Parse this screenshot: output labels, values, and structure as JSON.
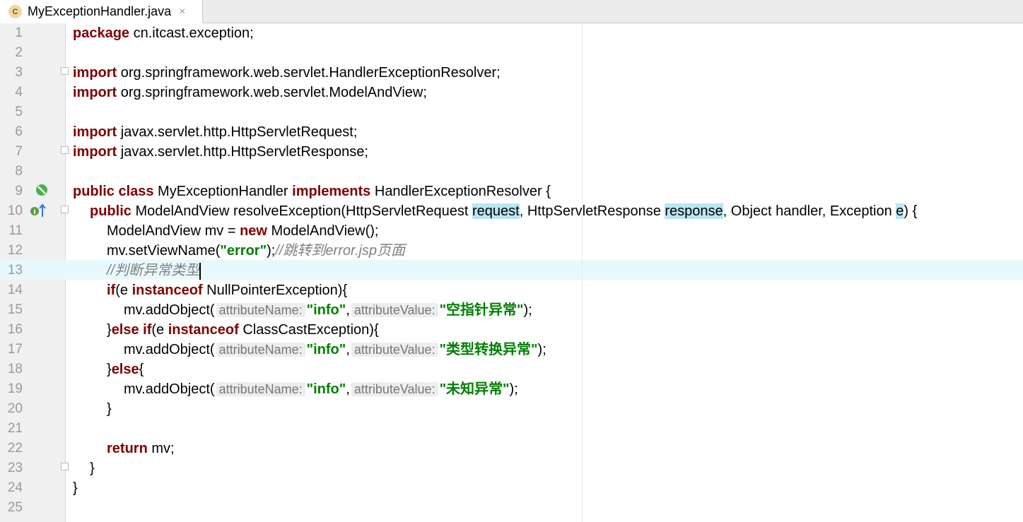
{
  "tab": {
    "icon": "C",
    "title": "MyExceptionHandler.java",
    "close": "×"
  },
  "lines": [
    {
      "n": "1"
    },
    {
      "n": "2"
    },
    {
      "n": "3"
    },
    {
      "n": "4"
    },
    {
      "n": "5"
    },
    {
      "n": "6"
    },
    {
      "n": "7"
    },
    {
      "n": "8"
    },
    {
      "n": "9"
    },
    {
      "n": "10"
    },
    {
      "n": "11"
    },
    {
      "n": "12"
    },
    {
      "n": "13"
    },
    {
      "n": "14"
    },
    {
      "n": "15"
    },
    {
      "n": "16"
    },
    {
      "n": "17"
    },
    {
      "n": "18"
    },
    {
      "n": "19"
    },
    {
      "n": "20"
    },
    {
      "n": "21"
    },
    {
      "n": "22"
    },
    {
      "n": "23"
    },
    {
      "n": "24"
    },
    {
      "n": "25"
    }
  ],
  "code": {
    "l1_kw": "package",
    "l1_rest": " cn.itcast.exception;",
    "l3_kw": "import",
    "l3_rest": " org.springframework.web.servlet.HandlerExceptionResolver;",
    "l4_kw": "import",
    "l4_rest": " org.springframework.web.servlet.ModelAndView;",
    "l6_kw": "import",
    "l6_rest": " javax.servlet.http.HttpServletRequest;",
    "l7_kw": "import",
    "l7_rest": " javax.servlet.http.HttpServletResponse;",
    "l9_kw1": "public class",
    "l9_name": " MyExceptionHandler ",
    "l9_kw2": "implements",
    "l9_rest": " HandlerExceptionResolver {",
    "l10_kw": "public",
    "l10_a": " ModelAndView resolveException(HttpServletRequest ",
    "l10_p1": "request",
    "l10_b": ", HttpServletResponse ",
    "l10_p2": "response",
    "l10_c": ", Object handler, Exception ",
    "l10_p3": "e",
    "l10_d": ") {",
    "l11_a": "ModelAndView mv = ",
    "l11_kw": "new",
    "l11_b": " ModelAndView();",
    "l12_a": "mv.setViewName(",
    "l12_str": "\"error\"",
    "l12_b": ");",
    "l12_cmt": "//跳转到error.jsp页面",
    "l13_cmt": "//判断异常类型",
    "l14_kw": "if",
    "l14_a": "(e ",
    "l14_kw2": "instanceof",
    "l14_b": " NullPointerException){",
    "l15_a": "mv.addObject(",
    "l15_h1": "attributeName:",
    "l15_s1": "\"info\"",
    "l15_c": ",",
    "l15_h2": "attributeValue:",
    "l15_s2": "\"空指针异常\"",
    "l15_b": ");",
    "l16_a": "}",
    "l16_kw": "else if",
    "l16_b": "(e ",
    "l16_kw2": "instanceof",
    "l16_c": " ClassCastException){",
    "l17_a": "mv.addObject(",
    "l17_h1": "attributeName:",
    "l17_s1": "\"info\"",
    "l17_c": ",",
    "l17_h2": "attributeValue:",
    "l17_s2": "\"类型转换异常\"",
    "l17_b": ");",
    "l18_a": "}",
    "l18_kw": "else",
    "l18_b": "{",
    "l19_a": "mv.addObject(",
    "l19_h1": "attributeName:",
    "l19_s1": "\"info\"",
    "l19_c": ",",
    "l19_h2": "attributeValue:",
    "l19_s2": "\"未知异常\"",
    "l19_b": ");",
    "l20": "}",
    "l22_kw": "return",
    "l22_b": " mv;",
    "l23": "}",
    "l24": "}"
  },
  "colors": {
    "keyword": "#000080",
    "string": "#008000",
    "comment": "#808080",
    "caret_row": "#e8f9fd",
    "highlight": "#b9e6f2"
  },
  "gutter_icons": [
    "no-entry-icon",
    "implements-method-icon"
  ]
}
